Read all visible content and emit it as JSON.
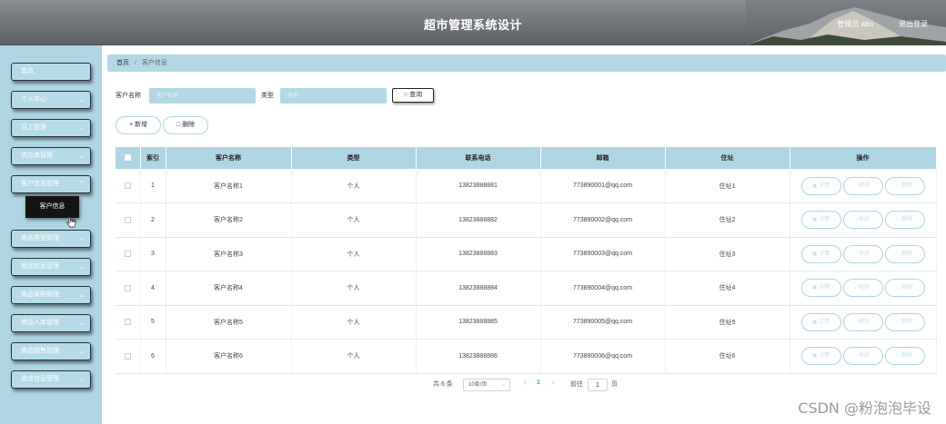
{
  "header": {
    "title": "超市管理系统设计",
    "user": "管理员 abo",
    "logout": "退出登录"
  },
  "sidebar": {
    "items": [
      {
        "label": "首页",
        "has_children": false
      },
      {
        "label": "个人中心",
        "has_children": true
      },
      {
        "label": "员工管理",
        "has_children": true
      },
      {
        "label": "供应商管理",
        "has_children": true
      },
      {
        "label": "客户信息管理",
        "has_children": true
      },
      {
        "label": "商品类型管理",
        "has_children": true
      },
      {
        "label": "商品信息管理",
        "has_children": true
      },
      {
        "label": "商品采购管理",
        "has_children": true
      },
      {
        "label": "商品入库管理",
        "has_children": true
      },
      {
        "label": "商品销售管理",
        "has_children": true
      },
      {
        "label": "盘点信息管理",
        "has_children": true
      }
    ],
    "active_submenu": "客户信息"
  },
  "breadcrumb": {
    "home": "首页",
    "separator": "/",
    "current": "客户信息"
  },
  "search": {
    "name_label": "客户名称",
    "name_placeholder": "客户名称",
    "type_label": "类型",
    "type_placeholder": "类型",
    "query_button": "查询"
  },
  "actions": {
    "add": "新增",
    "delete": "删除"
  },
  "table": {
    "headers": {
      "index": "索引",
      "name": "客户名称",
      "type": "类型",
      "phone": "联系电话",
      "email": "邮箱",
      "address": "住址",
      "ops": "操作"
    },
    "op_labels": {
      "detail": "详情",
      "edit": "修改",
      "delete": "删除"
    },
    "rows": [
      {
        "index": "1",
        "name": "客户名称1",
        "type": "个人",
        "phone": "13823888881",
        "email": "773890001@qq.com",
        "address": "住址1"
      },
      {
        "index": "2",
        "name": "客户名称2",
        "type": "个人",
        "phone": "13823888882",
        "email": "773890002@qq.com",
        "address": "住址2"
      },
      {
        "index": "3",
        "name": "客户名称3",
        "type": "个人",
        "phone": "13823888883",
        "email": "773890003@qq.com",
        "address": "住址3"
      },
      {
        "index": "4",
        "name": "客户名称4",
        "type": "个人",
        "phone": "13823888884",
        "email": "773890004@qq.com",
        "address": "住址4"
      },
      {
        "index": "5",
        "name": "客户名称5",
        "type": "个人",
        "phone": "13823888885",
        "email": "773890005@qq.com",
        "address": "住址5"
      },
      {
        "index": "6",
        "name": "客户名称6",
        "type": "个人",
        "phone": "13823888886",
        "email": "773890006@qq.com",
        "address": "住址6"
      }
    ]
  },
  "pagination": {
    "total": "共 6 条",
    "page_size": "10条/页",
    "prev": "<",
    "current_page": "1",
    "next": ">",
    "goto_label": "前往",
    "goto_value": "1",
    "page_unit": "页"
  },
  "watermark": "CSDN @粉泡泡毕设",
  "colors": {
    "accent": "#aed5e3",
    "header": "#6f7378",
    "active_submenu": "#141414"
  }
}
